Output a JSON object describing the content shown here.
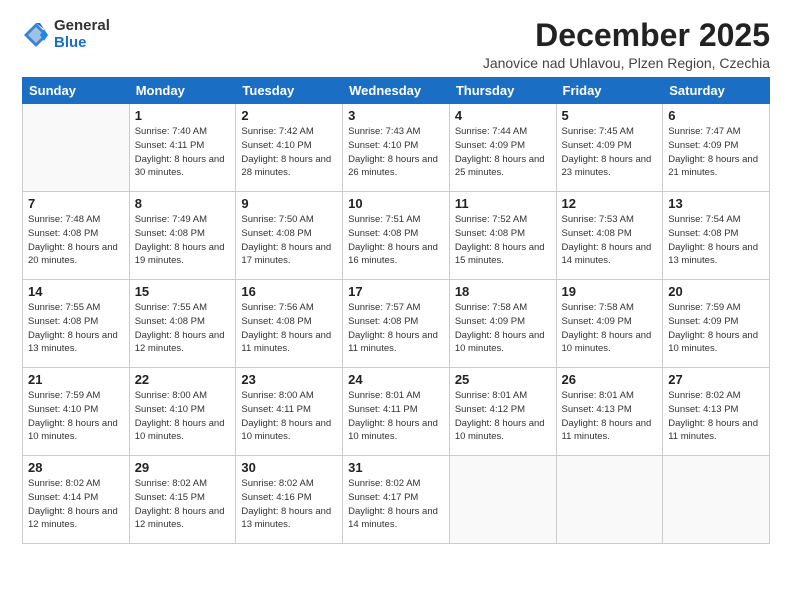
{
  "header": {
    "logo_general": "General",
    "logo_blue": "Blue",
    "month_title": "December 2025",
    "location": "Janovice nad Uhlavou, Plzen Region, Czechia"
  },
  "weekdays": [
    "Sunday",
    "Monday",
    "Tuesday",
    "Wednesday",
    "Thursday",
    "Friday",
    "Saturday"
  ],
  "weeks": [
    [
      {
        "day": "",
        "sunrise": "",
        "sunset": "",
        "daylight": ""
      },
      {
        "day": "1",
        "sunrise": "Sunrise: 7:40 AM",
        "sunset": "Sunset: 4:11 PM",
        "daylight": "Daylight: 8 hours and 30 minutes."
      },
      {
        "day": "2",
        "sunrise": "Sunrise: 7:42 AM",
        "sunset": "Sunset: 4:10 PM",
        "daylight": "Daylight: 8 hours and 28 minutes."
      },
      {
        "day": "3",
        "sunrise": "Sunrise: 7:43 AM",
        "sunset": "Sunset: 4:10 PM",
        "daylight": "Daylight: 8 hours and 26 minutes."
      },
      {
        "day": "4",
        "sunrise": "Sunrise: 7:44 AM",
        "sunset": "Sunset: 4:09 PM",
        "daylight": "Daylight: 8 hours and 25 minutes."
      },
      {
        "day": "5",
        "sunrise": "Sunrise: 7:45 AM",
        "sunset": "Sunset: 4:09 PM",
        "daylight": "Daylight: 8 hours and 23 minutes."
      },
      {
        "day": "6",
        "sunrise": "Sunrise: 7:47 AM",
        "sunset": "Sunset: 4:09 PM",
        "daylight": "Daylight: 8 hours and 21 minutes."
      }
    ],
    [
      {
        "day": "7",
        "sunrise": "Sunrise: 7:48 AM",
        "sunset": "Sunset: 4:08 PM",
        "daylight": "Daylight: 8 hours and 20 minutes."
      },
      {
        "day": "8",
        "sunrise": "Sunrise: 7:49 AM",
        "sunset": "Sunset: 4:08 PM",
        "daylight": "Daylight: 8 hours and 19 minutes."
      },
      {
        "day": "9",
        "sunrise": "Sunrise: 7:50 AM",
        "sunset": "Sunset: 4:08 PM",
        "daylight": "Daylight: 8 hours and 17 minutes."
      },
      {
        "day": "10",
        "sunrise": "Sunrise: 7:51 AM",
        "sunset": "Sunset: 4:08 PM",
        "daylight": "Daylight: 8 hours and 16 minutes."
      },
      {
        "day": "11",
        "sunrise": "Sunrise: 7:52 AM",
        "sunset": "Sunset: 4:08 PM",
        "daylight": "Daylight: 8 hours and 15 minutes."
      },
      {
        "day": "12",
        "sunrise": "Sunrise: 7:53 AM",
        "sunset": "Sunset: 4:08 PM",
        "daylight": "Daylight: 8 hours and 14 minutes."
      },
      {
        "day": "13",
        "sunrise": "Sunrise: 7:54 AM",
        "sunset": "Sunset: 4:08 PM",
        "daylight": "Daylight: 8 hours and 13 minutes."
      }
    ],
    [
      {
        "day": "14",
        "sunrise": "Sunrise: 7:55 AM",
        "sunset": "Sunset: 4:08 PM",
        "daylight": "Daylight: 8 hours and 13 minutes."
      },
      {
        "day": "15",
        "sunrise": "Sunrise: 7:55 AM",
        "sunset": "Sunset: 4:08 PM",
        "daylight": "Daylight: 8 hours and 12 minutes."
      },
      {
        "day": "16",
        "sunrise": "Sunrise: 7:56 AM",
        "sunset": "Sunset: 4:08 PM",
        "daylight": "Daylight: 8 hours and 11 minutes."
      },
      {
        "day": "17",
        "sunrise": "Sunrise: 7:57 AM",
        "sunset": "Sunset: 4:08 PM",
        "daylight": "Daylight: 8 hours and 11 minutes."
      },
      {
        "day": "18",
        "sunrise": "Sunrise: 7:58 AM",
        "sunset": "Sunset: 4:09 PM",
        "daylight": "Daylight: 8 hours and 10 minutes."
      },
      {
        "day": "19",
        "sunrise": "Sunrise: 7:58 AM",
        "sunset": "Sunset: 4:09 PM",
        "daylight": "Daylight: 8 hours and 10 minutes."
      },
      {
        "day": "20",
        "sunrise": "Sunrise: 7:59 AM",
        "sunset": "Sunset: 4:09 PM",
        "daylight": "Daylight: 8 hours and 10 minutes."
      }
    ],
    [
      {
        "day": "21",
        "sunrise": "Sunrise: 7:59 AM",
        "sunset": "Sunset: 4:10 PM",
        "daylight": "Daylight: 8 hours and 10 minutes."
      },
      {
        "day": "22",
        "sunrise": "Sunrise: 8:00 AM",
        "sunset": "Sunset: 4:10 PM",
        "daylight": "Daylight: 8 hours and 10 minutes."
      },
      {
        "day": "23",
        "sunrise": "Sunrise: 8:00 AM",
        "sunset": "Sunset: 4:11 PM",
        "daylight": "Daylight: 8 hours and 10 minutes."
      },
      {
        "day": "24",
        "sunrise": "Sunrise: 8:01 AM",
        "sunset": "Sunset: 4:11 PM",
        "daylight": "Daylight: 8 hours and 10 minutes."
      },
      {
        "day": "25",
        "sunrise": "Sunrise: 8:01 AM",
        "sunset": "Sunset: 4:12 PM",
        "daylight": "Daylight: 8 hours and 10 minutes."
      },
      {
        "day": "26",
        "sunrise": "Sunrise: 8:01 AM",
        "sunset": "Sunset: 4:13 PM",
        "daylight": "Daylight: 8 hours and 11 minutes."
      },
      {
        "day": "27",
        "sunrise": "Sunrise: 8:02 AM",
        "sunset": "Sunset: 4:13 PM",
        "daylight": "Daylight: 8 hours and 11 minutes."
      }
    ],
    [
      {
        "day": "28",
        "sunrise": "Sunrise: 8:02 AM",
        "sunset": "Sunset: 4:14 PM",
        "daylight": "Daylight: 8 hours and 12 minutes."
      },
      {
        "day": "29",
        "sunrise": "Sunrise: 8:02 AM",
        "sunset": "Sunset: 4:15 PM",
        "daylight": "Daylight: 8 hours and 12 minutes."
      },
      {
        "day": "30",
        "sunrise": "Sunrise: 8:02 AM",
        "sunset": "Sunset: 4:16 PM",
        "daylight": "Daylight: 8 hours and 13 minutes."
      },
      {
        "day": "31",
        "sunrise": "Sunrise: 8:02 AM",
        "sunset": "Sunset: 4:17 PM",
        "daylight": "Daylight: 8 hours and 14 minutes."
      },
      {
        "day": "",
        "sunrise": "",
        "sunset": "",
        "daylight": ""
      },
      {
        "day": "",
        "sunrise": "",
        "sunset": "",
        "daylight": ""
      },
      {
        "day": "",
        "sunrise": "",
        "sunset": "",
        "daylight": ""
      }
    ]
  ]
}
